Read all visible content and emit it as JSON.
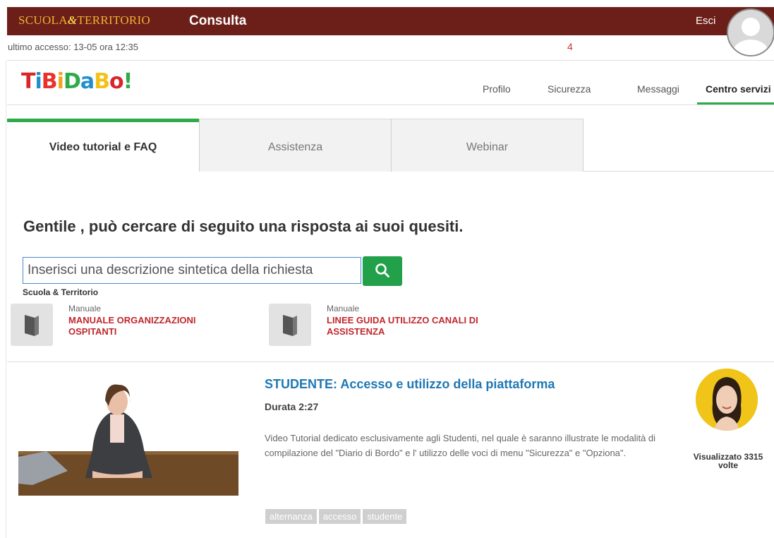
{
  "topbar": {
    "brand_prefix": "SCUOLA",
    "brand_amp": "&",
    "brand_suffix": "TERRITORIO",
    "app_title": "Consulta",
    "logout_label": "Esci"
  },
  "infobar": {
    "last_access": "ultimo accesso: 13-05 ora 12:35",
    "notification_count": "4"
  },
  "logo": {
    "letters": [
      "T",
      "i",
      "B",
      "i",
      "D",
      "a",
      "B",
      "o",
      "!"
    ]
  },
  "nav": {
    "items": [
      {
        "label": "Profilo"
      },
      {
        "label": "Sicurezza"
      },
      {
        "label": "Messaggi"
      },
      {
        "label": "Centro servizi"
      }
    ]
  },
  "tabs": [
    {
      "label": "Video tutorial e FAQ"
    },
    {
      "label": "Assistenza"
    },
    {
      "label": "Webinar"
    }
  ],
  "search": {
    "heading": "Gentile , può cercare di seguito una risposta ai suoi quesiti.",
    "placeholder": "Inserisci una descrizione sintetica della richiesta",
    "org_label": "Scuola & Territorio"
  },
  "manuals": [
    {
      "kind": "Manuale",
      "title": "MANUALE ORGANIZZAZIONI OSPITANTI"
    },
    {
      "kind": "Manuale",
      "title": "LINEE GUIDA UTILIZZO CANALI DI ASSISTENZA"
    }
  ],
  "video": {
    "title": "STUDENTE: Accesso e utilizzo della piattaforma",
    "duration": "Durata 2:27",
    "description": "Video Tutorial dedicato esclusivamente agli Studenti, nel quale è saranno illustrate le modalità di compilazione del \"Diario di Bordo\" e l' utilizzo delle voci di menu \"Sicurezza\" e \"Opziona\".",
    "views": "Visualizzato 3315 volte",
    "tags": [
      "alternanza",
      "accesso",
      "studente"
    ]
  },
  "colors": {
    "topbar": "#6b1f18",
    "accent_green": "#2eaa4a",
    "link_blue": "#1f78b4",
    "manual_red": "#c0282d"
  }
}
